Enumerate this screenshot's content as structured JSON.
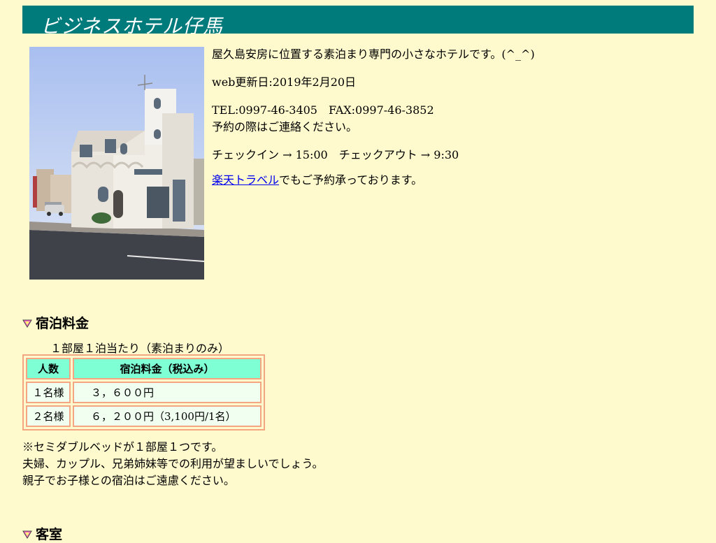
{
  "header": {
    "title": "ビジネスホテル仔馬"
  },
  "intro": {
    "description": "屋久島安房に位置する素泊まり専門の小さなホテルです。(^_^)",
    "updated": "web更新日:2019年2月20日",
    "tel": "TEL:0997-46-3405",
    "fax": "FAX:0997-46-3852",
    "contact_note": "予約の際はご連絡ください。",
    "checkin": "チェックイン → 15:00",
    "checkout": "チェックアウト → 9:30",
    "rakuten_link": "楽天トラベル",
    "rakuten_suffix": "でもご予約承っております。"
  },
  "rates": {
    "heading": "宿泊料金",
    "note": "１部屋１泊当たり（素泊まりのみ）",
    "columns": [
      "人数",
      "宿泊料金（税込み）"
    ],
    "rows": [
      {
        "people": "１名様",
        "price": "３，６００円"
      },
      {
        "people": "２名様",
        "price": "６，２００円（3,100円/1名）"
      }
    ]
  },
  "notes": [
    "※セミダブルベッドが１部屋１つです。",
    "夫婦、カップル、兄弟姉妹等での利用が望ましいでしょう。",
    "親子でお子様との宿泊はご遠慮ください。"
  ],
  "rooms": {
    "heading": "客室"
  },
  "colors": {
    "background": "#fffacd",
    "banner": "#007b7b",
    "table_header": "#7fffd4",
    "table_border": "#f4a582",
    "link": "#0000ee"
  },
  "icons": {
    "section_marker": "down-triangle-icon",
    "photo": "hotel-building-photo"
  }
}
